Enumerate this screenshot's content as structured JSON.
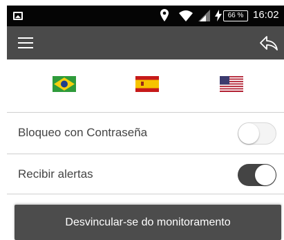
{
  "status_bar": {
    "battery": "66 %",
    "time": "16:02",
    "icons": [
      "image-icon",
      "location-icon",
      "wifi-icon",
      "signal-icon",
      "charging-icon",
      "battery-icon"
    ]
  },
  "app_bar": {
    "background": "#4a4a4a",
    "icons": [
      "menu-icon",
      "share-icon"
    ]
  },
  "languages": [
    "brazil-flag",
    "spain-flag",
    "usa-flag"
  ],
  "settings": [
    {
      "label": "Bloqueo con Contraseña",
      "enabled": false
    },
    {
      "label": "Recibir alertas",
      "enabled": true
    }
  ],
  "unlink_button": {
    "label": "Desvincular-se do monitoramento"
  }
}
